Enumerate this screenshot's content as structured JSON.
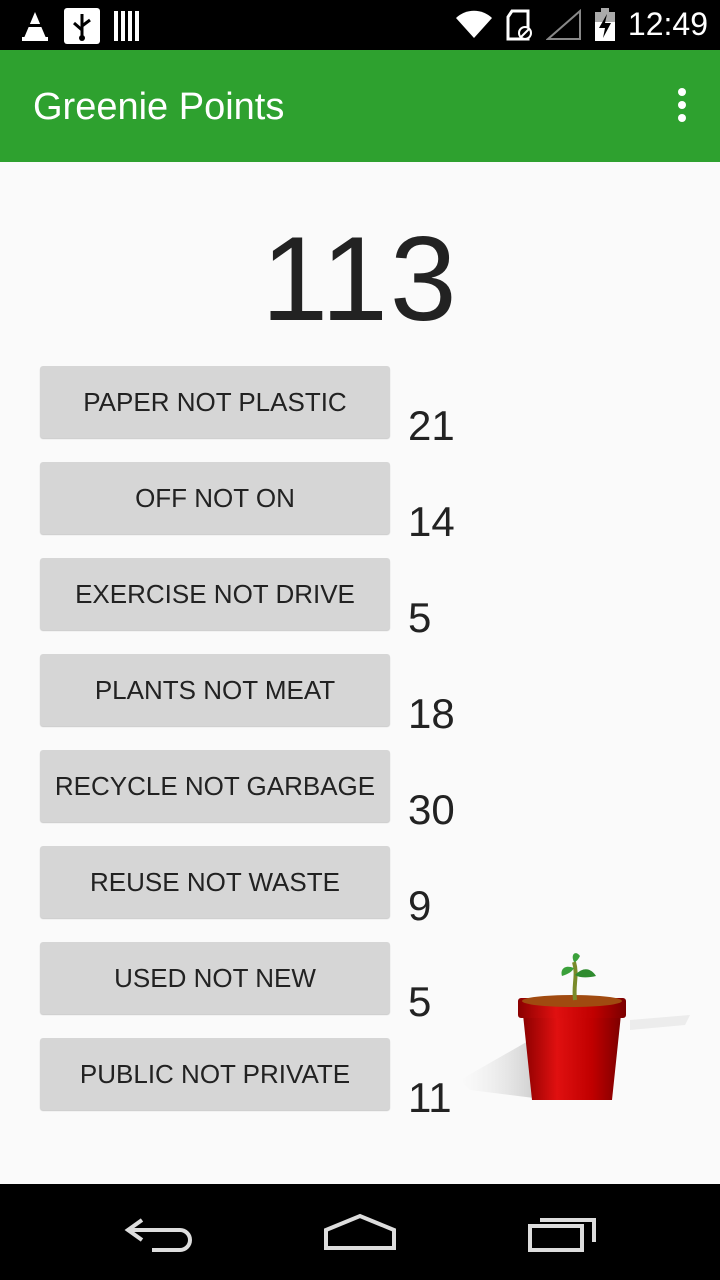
{
  "status_bar": {
    "time": "12:49",
    "icons": [
      "vlc-cone-icon",
      "usb-icon",
      "barcode-icon",
      "wifi-icon",
      "sd-card-icon",
      "signal-icon",
      "battery-charging-icon"
    ]
  },
  "app_bar": {
    "title": "Greenie Points",
    "menu_icon": "overflow-menu-icon"
  },
  "total_points": "113",
  "actions": [
    {
      "label": "PAPER NOT PLASTIC",
      "count": "21"
    },
    {
      "label": "OFF NOT ON",
      "count": "14"
    },
    {
      "label": "EXERCISE NOT DRIVE",
      "count": "5"
    },
    {
      "label": "PLANTS NOT MEAT",
      "count": "18"
    },
    {
      "label": "RECYCLE NOT GARBAGE",
      "count": "30"
    },
    {
      "label": "REUSE NOT WASTE",
      "count": "9"
    },
    {
      "label": "USED NOT NEW",
      "count": "5"
    },
    {
      "label": "PUBLIC NOT PRIVATE",
      "count": "11"
    }
  ],
  "nav_bar": {
    "icons": [
      "back-icon",
      "home-icon",
      "recent-apps-icon"
    ]
  }
}
